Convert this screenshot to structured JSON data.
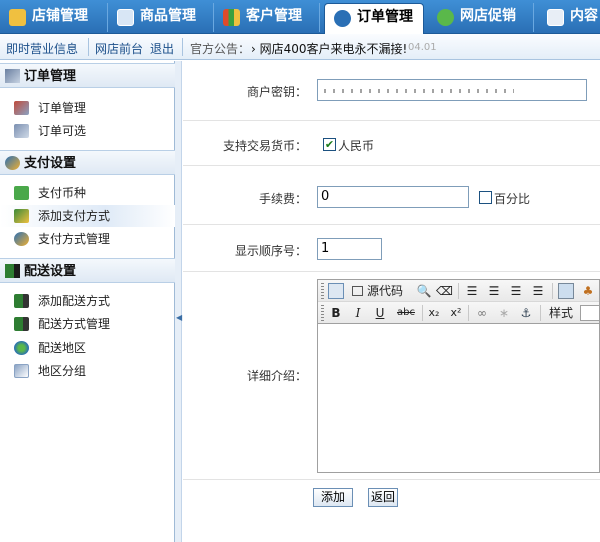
{
  "top_tabs": [
    {
      "label": "店铺管理",
      "icon": "store-icon"
    },
    {
      "label": "商品管理",
      "icon": "grid-icon"
    },
    {
      "label": "客户管理",
      "icon": "users-icon"
    },
    {
      "label": "订单管理",
      "icon": "order-icon",
      "active": true
    },
    {
      "label": "网店促销",
      "icon": "promo-icon"
    },
    {
      "label": "内容",
      "icon": "content-icon"
    }
  ],
  "subbar": {
    "business_info": "即时营业信息",
    "front_link": "网店前台",
    "logout": "退出",
    "notice_label": "官方公告：",
    "notice_text": "› 网店400客户来电永不漏接!",
    "notice_date": "04.01"
  },
  "sidebar": {
    "groups": [
      {
        "title": "订单管理",
        "items": [
          "订单管理",
          "订单可选"
        ]
      },
      {
        "title": "支付设置",
        "items": [
          "支付币种",
          "添加支付方式",
          "支付方式管理"
        ]
      },
      {
        "title": "配送设置",
        "items": [
          "添加配送方式",
          "配送方式管理",
          "配送地区",
          "地区分组"
        ]
      }
    ],
    "selected_item": "添加支付方式"
  },
  "form": {
    "merchant_key_label": "商户密钥：",
    "currency_label": "支持交易货币：",
    "currency_option": "人民币",
    "currency_checked": true,
    "fee_label": "手续费：",
    "fee_value": "0",
    "percent_label": "百分比",
    "percent_checked": false,
    "order_label": "显示顺序号：",
    "order_value": "1",
    "detail_label": "详细介绍：",
    "source_code": "源代码",
    "style_label": "样式",
    "submit": "添加",
    "back": "返回"
  }
}
